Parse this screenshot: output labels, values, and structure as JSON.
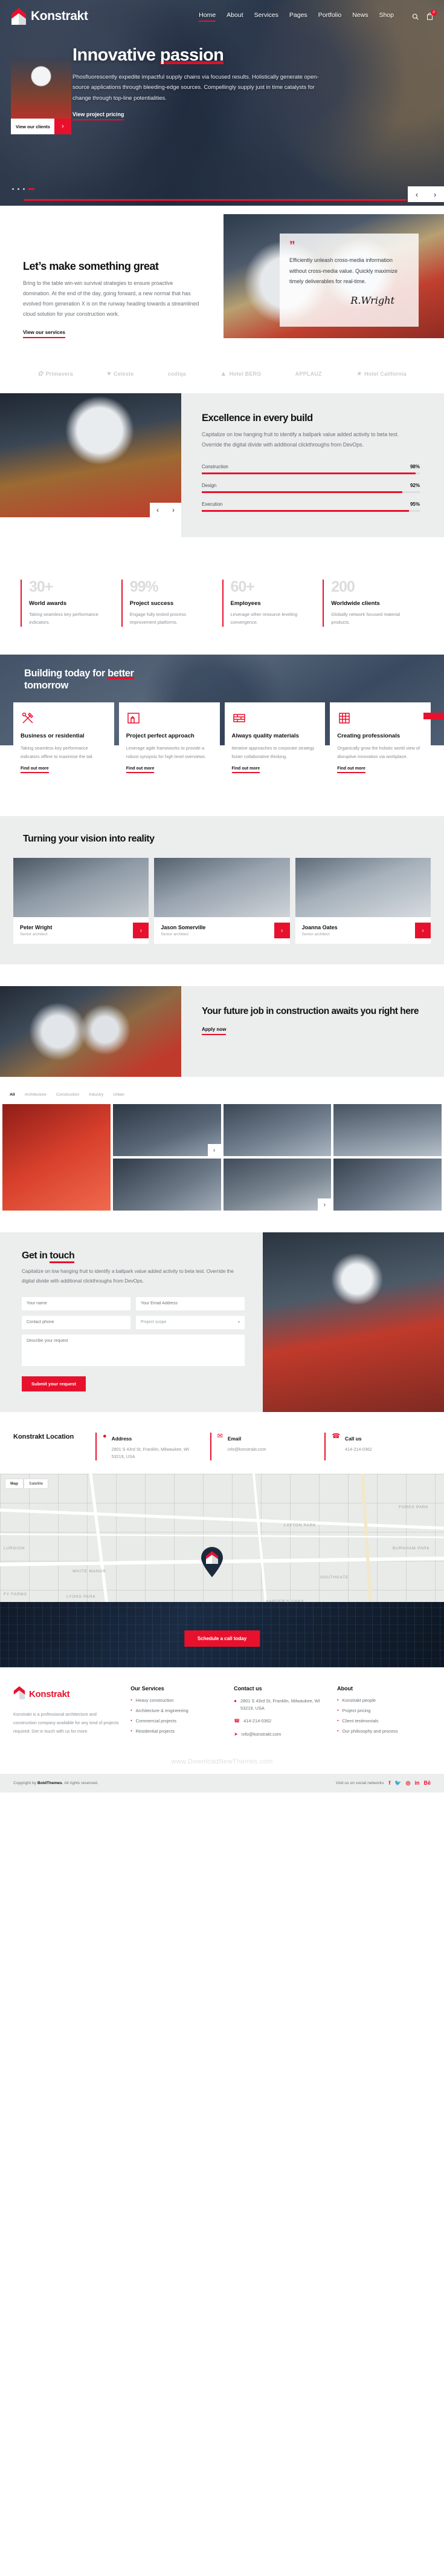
{
  "brand": {
    "name": "Konstrakt",
    "accent": "#e8112d",
    "logo_icon": "red-house-chevron-logo"
  },
  "nav": {
    "items": [
      {
        "label": "Home",
        "active": true
      },
      {
        "label": "About",
        "active": false
      },
      {
        "label": "Services",
        "active": false
      },
      {
        "label": "Pages",
        "active": false
      },
      {
        "label": "Portfolio",
        "active": false
      },
      {
        "label": "News",
        "active": false
      },
      {
        "label": "Shop",
        "active": false
      }
    ],
    "search_icon": "search-icon",
    "cart_icon": "shopping-bag-icon",
    "cart_count": "0"
  },
  "hero": {
    "title_plain": "Innovative ",
    "title_highlight": "passion",
    "paragraph": "Phosfluorescently expedite impactful supply chains via focused results. Holistically generate open-source applications through bleeding-edge sources. Compellingly supply just in time catalysts for change through top-line potentialities.",
    "link": "View project pricing",
    "card_label": "View our clients",
    "card_arrow": "›",
    "prev_arrow": "‹",
    "next_arrow": "›",
    "slide_count": 4,
    "active_slide": 4
  },
  "great": {
    "title": "Let’s make something great",
    "paragraph": "Bring to the table win-win survival strategies to ensure proactive domination. At the end of the day, going forward, a new normal that has evolved from generation X is on the runway heading towards a streamlined cloud solution for your construction work.",
    "link": "View our services",
    "quote_mark": "”",
    "quote": "Efficiently unleash cross-media information without cross-media value. Quickly maximize timely deliverables for real-time.",
    "signature": "R.Wright"
  },
  "brands": [
    {
      "name": "Primavera",
      "glyph": "✿"
    },
    {
      "name": "Celeste",
      "glyph": "♥"
    },
    {
      "name": "codiqa",
      "glyph": "‹›"
    },
    {
      "name": "Hotel BERG",
      "glyph": "▲"
    },
    {
      "name": "APPLAUZ",
      "glyph": ""
    },
    {
      "name": "Hotel California",
      "glyph": "★"
    }
  ],
  "excellence": {
    "title": "Excellence in every build",
    "paragraph": "Capitalize on low hanging fruit to identify a ballpark value added activity to beta test. Override the digital divide with additional clickthroughs from DevOps.",
    "prev_arrow": "‹",
    "next_arrow": "›"
  },
  "chart_data": {
    "type": "bar",
    "title": "Excellence in every build — skill bars",
    "categories": [
      "Construction",
      "Design",
      "Execution"
    ],
    "values": [
      98,
      92,
      95
    ],
    "value_labels": [
      "98%",
      "92%",
      "95%"
    ],
    "ylim": [
      0,
      100
    ],
    "xlabel": "",
    "ylabel": "",
    "grid": false,
    "legend": "none",
    "orientation": "horizontal",
    "bar_color": "#e8112d",
    "track_color": "#dcdedf"
  },
  "stats": [
    {
      "number": "30+",
      "title": "World awards",
      "desc": "Taking seamless key performance indicators."
    },
    {
      "number": "99%",
      "title": "Project success",
      "desc": "Engage fully tested process improvement platforms."
    },
    {
      "number": "60+",
      "title": "Employees",
      "desc": "Leverage other resource leveling convergence."
    },
    {
      "number": "200",
      "title": "Worldwide clients",
      "desc": "Globally network focused material products."
    }
  ],
  "building": {
    "title_plain_1": "Building today for ",
    "title_highlight": "better",
    "title_plain_2": "tomorrow",
    "cards": [
      {
        "icon": "hammer-and-wrench-icon",
        "title": "Business or residential",
        "desc": "Taking seamless key performance indicators offline to maximise the tail.",
        "cta": "Find out more"
      },
      {
        "icon": "blueprint-icon",
        "title": "Project perfect approach",
        "desc": "Leverage agile frameworks to provide a robust synopsis for high level overviews.",
        "cta": "Find out more"
      },
      {
        "icon": "brick-wall-icon",
        "title": "Always quality materials",
        "desc": "Iterative approaches to corporate strategy foster collaborative thinking.",
        "cta": "Find out more"
      },
      {
        "icon": "building-grid-icon",
        "title": "Creating professionals",
        "desc": "Organically grow the holistic world view of disruptive innovation via workplace.",
        "cta": "Find out more"
      }
    ]
  },
  "team": {
    "title": "Turning your vision into reality",
    "members": [
      {
        "name": "Peter Wright",
        "role": "Senior architect",
        "arrow": "›"
      },
      {
        "name": "Jason Somerville",
        "role": "Senior architect",
        "arrow": "›"
      },
      {
        "name": "Joanna Oates",
        "role": "Senior architect",
        "arrow": "›"
      }
    ]
  },
  "job": {
    "title": "Your future job in construction awaits you right here",
    "button": "Apply now"
  },
  "portfolio": {
    "filters": [
      {
        "label": "All",
        "active": true
      },
      {
        "label": "Architecture",
        "active": false
      },
      {
        "label": "Construction",
        "active": false
      },
      {
        "label": "Industry",
        "active": false
      },
      {
        "label": "Urban",
        "active": false
      }
    ],
    "badge": "›"
  },
  "contact": {
    "title_plain": "Get in ",
    "title_underline": "touch",
    "paragraph": "Capitalize on low hanging fruit to identify a ballpark value added activity to beta test. Override the digital divide with additional clickthroughs from DevOps.",
    "fields": {
      "name_placeholder": "Your name",
      "email_placeholder": "Your Email Address",
      "phone_placeholder": "Contact phone",
      "project_placeholder": "Project scope",
      "message_placeholder": "Describe your request"
    },
    "required_mark": "*",
    "submit": "Submit your request"
  },
  "location": {
    "title": "Konstrakt Location",
    "items": [
      {
        "icon": "map-pin-icon",
        "heading": "Address",
        "value": "2801 S 43rd St, Franklin, Milwaukee, WI 53219, USA"
      },
      {
        "icon": "envelope-icon",
        "heading": "Email",
        "value": "info@konstrakt.com"
      },
      {
        "icon": "phone-icon",
        "heading": "Call us",
        "value": "414-214-0362"
      }
    ]
  },
  "map": {
    "tabs": [
      {
        "label": "Map",
        "active": true
      },
      {
        "label": "Satellite",
        "active": false
      }
    ],
    "labels": [
      "LAYTON PARK",
      "WHITE MANOR",
      "SOUTHGATE",
      "LYONS PARK",
      "FORES PARK",
      "BURNHAM PARK",
      "HARDER'S OAKS",
      "LURGION",
      "FY FARMS"
    ],
    "pin_icon": "location-pin-icon",
    "schedule_button": "Schedule a call today"
  },
  "footer": {
    "brand": "Konstrakt",
    "about": "Konstrakt is a professional architecture and construction company available for any kind of projects required. Get in touch with us for more.",
    "columns": [
      {
        "heading": "Our Services",
        "items": [
          "Heavy construction",
          "Architecture & engineering",
          "Commercial projects",
          "Residential projects"
        ]
      },
      {
        "heading": "About",
        "items": [
          "Konstrakt people",
          "Project pricing",
          "Client testimonials",
          "Our philosophy and process"
        ]
      }
    ],
    "contact_heading": "Contact us",
    "contact_items": [
      {
        "icon": "map-pin-icon",
        "text": "2801 S 43rd St, Franklin, Milwaukee, WI 53219, USA"
      },
      {
        "icon": "phone-icon",
        "text": "414-214-0362"
      },
      {
        "icon": "paper-plane-icon",
        "text": "info@konstrakt.com"
      }
    ],
    "watermark": "www.DownloadNewThemes.com",
    "copyright_prefix": "Copyright by ",
    "copyright_brand": "BoldThemes",
    "copyright_suffix": ". All rights reserved.",
    "social_label": "Visit us on social networks",
    "socials": [
      "f",
      "🐦",
      "◎",
      "in",
      "Bē"
    ]
  }
}
